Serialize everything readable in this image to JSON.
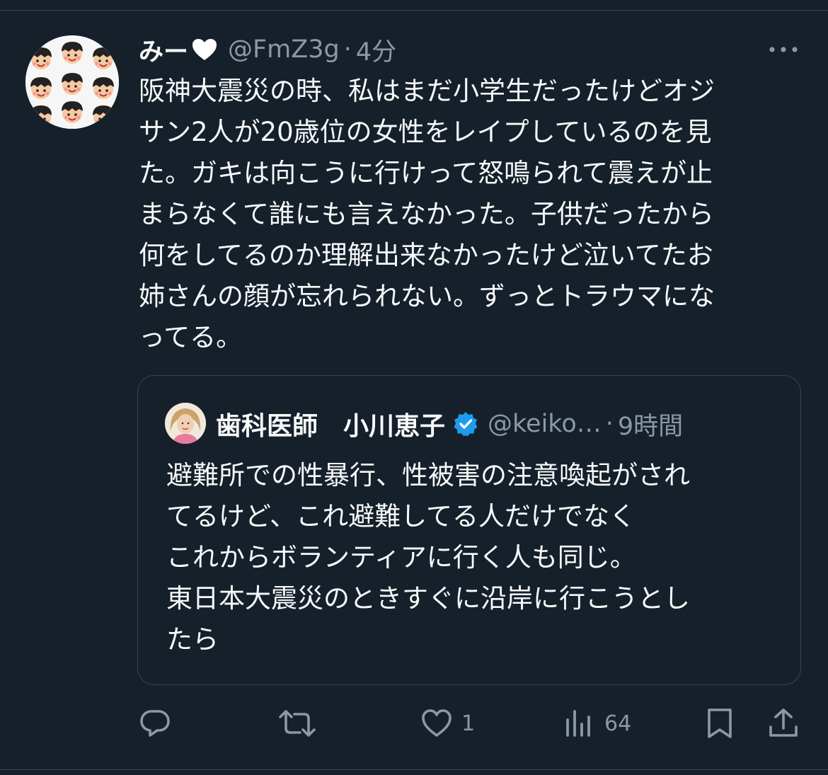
{
  "tweet": {
    "display_name": "みー",
    "handle": "@FmZ3g",
    "separator": "·",
    "time": "4分",
    "text_lines": [
      "阪神大震災の時、私はまだ小学生だったけどオジ",
      "サン2人が20歳位の女性をレイプしているのを見",
      "た。ガキは向こうに行けって怒鳴られて震えが止",
      "まらなくて誰にも言えなかった。子供だったから",
      "何をしてるのか理解出来なかったけど泣いてたお",
      "姉さんの顔が忘れられない。ずっとトラウマにな",
      "ってる。"
    ]
  },
  "quote": {
    "display_name": "歯科医師　小川恵子",
    "handle": "@keiko…",
    "separator": "·",
    "time": "9時間",
    "text_lines": [
      "避難所での性暴行、性被害の注意喚起がされ",
      "てるけど、これ避難してる人だけでなく",
      "これからボランティアに行く人も同じ。",
      "東日本大震災のときすぐに沿岸に行こうとし",
      "たら"
    ]
  },
  "actions": {
    "reply_count": "",
    "retweet_count": "",
    "like_count": "1",
    "views_count": "64"
  },
  "colors": {
    "background": "#15202b",
    "text": "#f7f9f9",
    "muted": "#8b98a5",
    "border": "#38444d",
    "heart": "#ffffff",
    "verified": "#1d9bf0"
  },
  "icons": [
    "heart-emoji-icon",
    "more-icon",
    "verified-badge-icon",
    "reply-icon",
    "retweet-icon",
    "like-icon",
    "views-icon",
    "bookmark-icon",
    "share-icon"
  ]
}
